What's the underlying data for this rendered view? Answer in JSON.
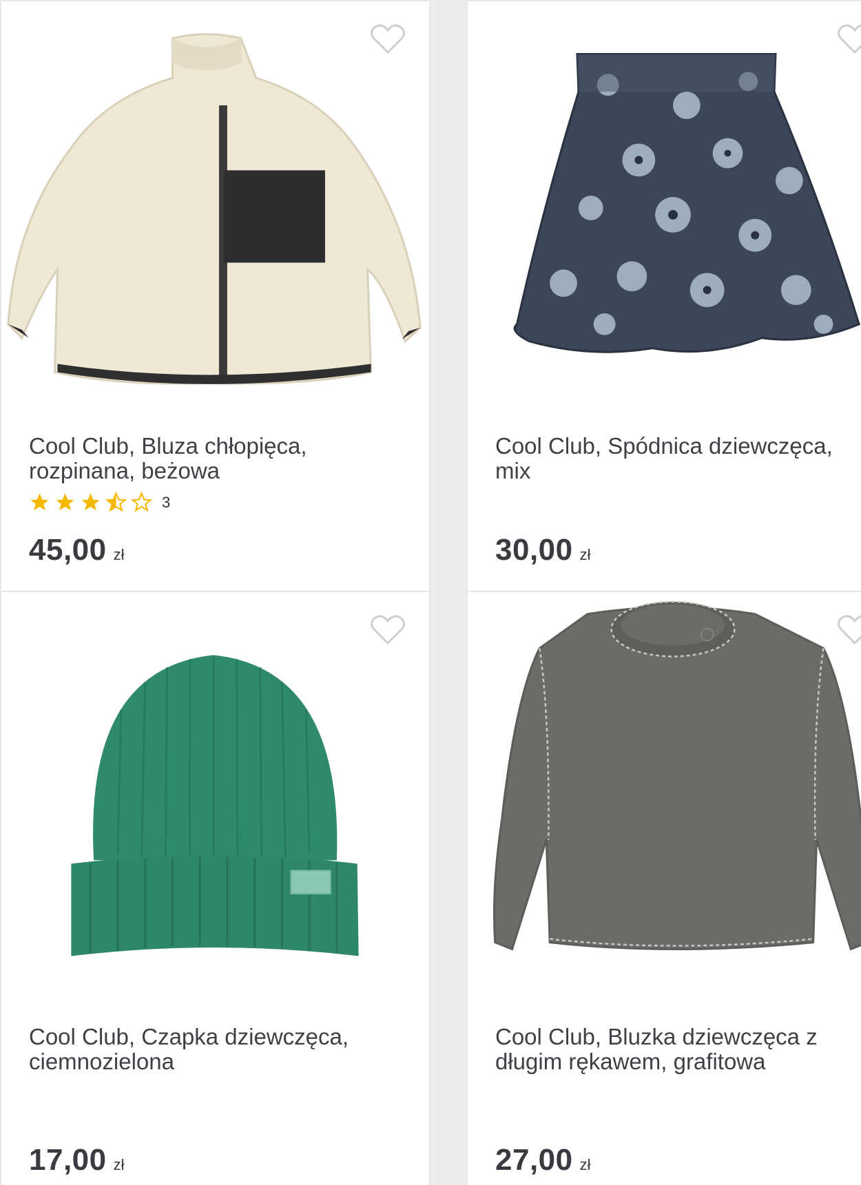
{
  "products": [
    {
      "title_line1": "Cool Club, Bluza chłopięca,",
      "title_line2": "rozpinana, beżowa",
      "price": "45,00",
      "currency": "zł",
      "rating": 3.5,
      "rating_count": "3"
    },
    {
      "title_line1": "Cool Club, Spódnica dziewczęca,",
      "title_line2": "mix",
      "price": "30,00",
      "currency": "zł"
    },
    {
      "title_line1": "Cool Club, Czapka dziewczęca,",
      "title_line2": "ciemnozielona",
      "price": "17,00",
      "currency": "zł"
    },
    {
      "title_line1": "Cool Club, Bluzka dziewczęca z",
      "title_line2": "długim rękawem, grafitowa",
      "price": "27,00",
      "currency": "zł"
    }
  ],
  "colors": {
    "star": "#f5b800",
    "heart": "#cfcfcf",
    "text": "#3f3f46",
    "background": "#ededed"
  },
  "icons": {
    "favorite": "heart-outline-icon",
    "rating": "star-icon"
  }
}
